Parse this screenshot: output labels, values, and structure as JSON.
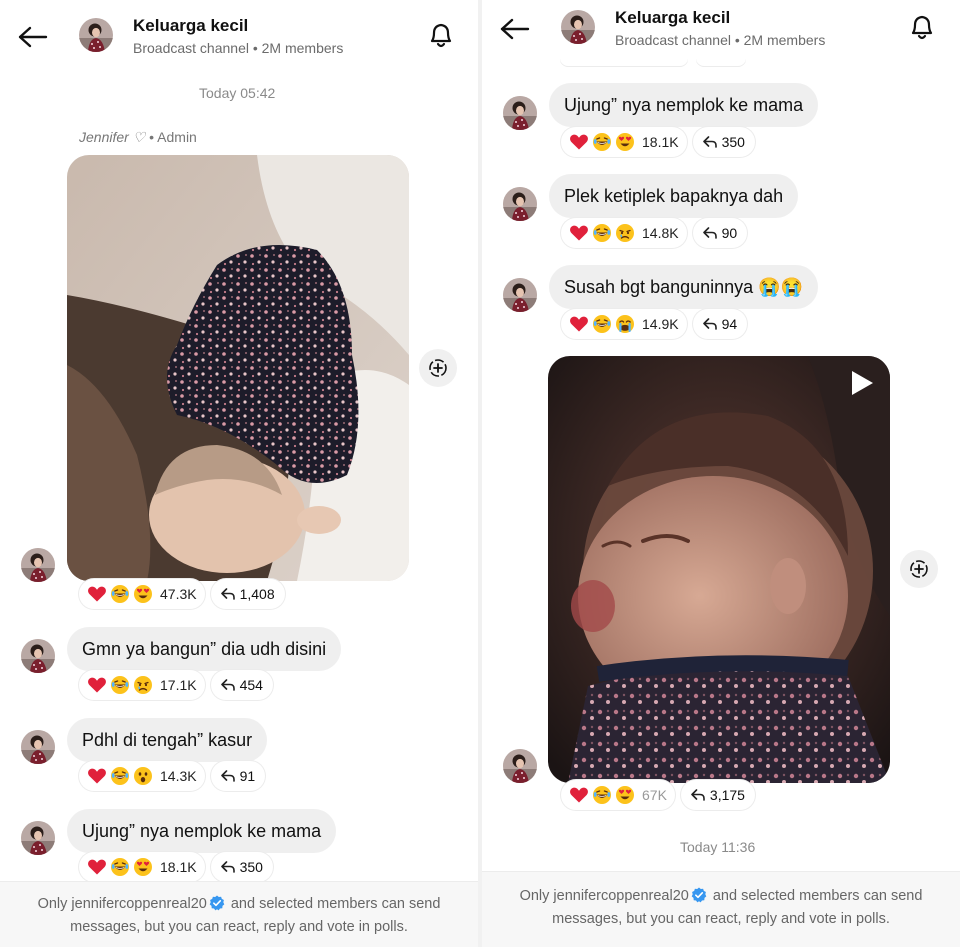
{
  "channel": {
    "name": "Keluarga kecil",
    "subtitle": "Broadcast channel • 2M members"
  },
  "left": {
    "timestamp": "Today 05:42",
    "sender": {
      "name": "Jennifer ♡",
      "role": " • Admin"
    },
    "photo_reactions": {
      "count": "47.3K",
      "replies": "1,408"
    },
    "messages": [
      {
        "text": "Gmn ya bangun” dia udh disini",
        "count": "17.1K",
        "replies": "454",
        "third_emoji": "disappointed"
      },
      {
        "text": "Pdhl di tengah” kasur",
        "count": "14.3K",
        "replies": "91",
        "third_emoji": "astonished"
      },
      {
        "text": "Ujung” nya nemplok ke mama",
        "count": "18.1K",
        "replies": "350",
        "third_emoji": "heart-eyes"
      }
    ]
  },
  "right": {
    "messages": [
      {
        "text": "Ujung” nya nemplok ke mama",
        "count": "18.1K",
        "replies": "350",
        "third_emoji": "heart-eyes"
      },
      {
        "text": "Plek ketiplek bapaknya dah",
        "count": "14.8K",
        "replies": "90",
        "third_emoji": "disappointed"
      },
      {
        "text": "Susah bgt banguninnya 😭😭",
        "count": "14.9K",
        "replies": "94",
        "third_emoji": "crying"
      }
    ],
    "video_reactions": {
      "count": "67K",
      "replies": "3,175"
    },
    "timestamp": "Today 11:36"
  },
  "footer": {
    "prefix": "Only jennifercoppenreal20",
    "line1_suffix": " and selected members can send",
    "line2": "messages, but you can react, reply and vote in polls."
  },
  "colors": {
    "verified": "#3797f0",
    "bubble": "#efefef",
    "heart": "#e0213b"
  },
  "icons": [
    "back-arrow-icon",
    "bell-icon",
    "share-plus-icon",
    "reply-arrow-icon",
    "play-icon",
    "verified-badge-icon"
  ]
}
